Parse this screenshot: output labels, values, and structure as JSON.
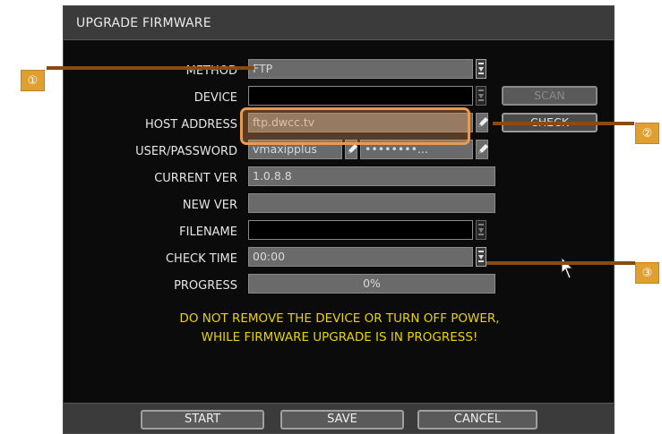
{
  "dialog": {
    "title": "UPGRADE FIRMWARE",
    "fields": {
      "method": {
        "label": "METHOD",
        "value": "FTP"
      },
      "device": {
        "label": "DEVICE",
        "value": ""
      },
      "host_address": {
        "label": "HOST ADDRESS",
        "value": "ftp.dwcc.tv"
      },
      "user_password": {
        "label": "USER/PASSWORD",
        "user": "vmaxipplus",
        "password": "••••••••..."
      },
      "current_ver": {
        "label": "CURRENT VER",
        "value": "1.0.8.8"
      },
      "new_ver": {
        "label": "NEW VER",
        "value": ""
      },
      "filename": {
        "label": "FILENAME",
        "value": ""
      },
      "check_time": {
        "label": "CHECK TIME",
        "value": "00:00"
      },
      "progress": {
        "label": "PROGRESS",
        "value": "0%",
        "fraction": 0
      }
    },
    "buttons": {
      "scan": "SCAN",
      "check": "CHECK"
    },
    "warning": [
      "DO NOT REMOVE THE DEVICE OR TURN OFF POWER,",
      "WHILE FIRMWARE UPGRADE IS IN PROGRESS!"
    ],
    "footer": {
      "start": "START",
      "save": "SAVE",
      "cancel": "CANCEL"
    }
  },
  "callouts": [
    "①",
    "②",
    "③"
  ],
  "colors": {
    "warning": "#e8d300",
    "callout_marker": "#e0a030",
    "callout_line": "#8a4a12",
    "highlight": "#e79a52"
  }
}
